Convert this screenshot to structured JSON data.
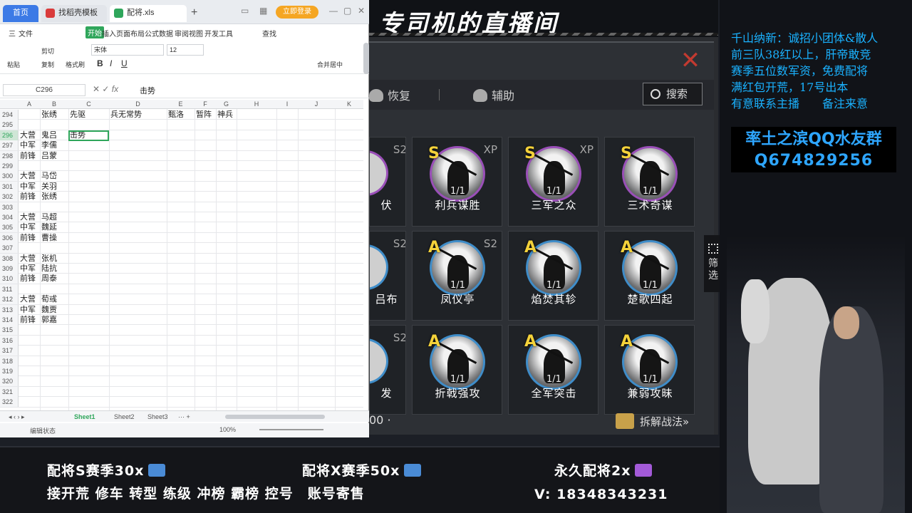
{
  "stream": {
    "title": "专司机的直播间"
  },
  "game": {
    "tabs": {
      "recover": "恢复",
      "assist": "辅助"
    },
    "search": "搜索",
    "filter": "筛选",
    "bottom_number": "00 ·",
    "dismantle": "拆解战法»",
    "cards": [
      {
        "grade": "",
        "tag": "S2",
        "level": "",
        "name": "伏",
        "partial": true,
        "color": "s"
      },
      {
        "grade": "S",
        "tag": "XP",
        "level": "1/1",
        "name": "利兵谋胜"
      },
      {
        "grade": "S",
        "tag": "XP",
        "level": "1/1",
        "name": "三军之众"
      },
      {
        "grade": "S",
        "tag": "",
        "level": "1/1",
        "name": "三术奇谋"
      },
      {
        "grade": "",
        "tag": "S2",
        "level": "",
        "name": "吕布",
        "partial": true,
        "color": "a"
      },
      {
        "grade": "A",
        "tag": "S2",
        "level": "1/1",
        "name": "凤仪亭"
      },
      {
        "grade": "A",
        "tag": "",
        "level": "1/1",
        "name": "焰焚其轸"
      },
      {
        "grade": "A",
        "tag": "",
        "level": "1/1",
        "name": "楚歌四起"
      },
      {
        "grade": "",
        "tag": "S2",
        "level": "",
        "name": "发",
        "partial": true,
        "color": "a"
      },
      {
        "grade": "A",
        "tag": "",
        "level": "1/1",
        "name": "折戟强攻"
      },
      {
        "grade": "A",
        "tag": "",
        "level": "1/1",
        "name": "全军突击"
      },
      {
        "grade": "A",
        "tag": "",
        "level": "1/1",
        "name": "兼弱攻昧"
      }
    ]
  },
  "notice": {
    "lines": [
      "千山纳新：诚招小团体&散人",
      "前三队38红以上，肝帝敢竞",
      "赛季五位数军资，免费配将",
      "满红包开荒，17号出本",
      "有意联系主播　　备注来意"
    ],
    "qq_name": "率土之滨QQ水友群",
    "qq_number": "Q674829256"
  },
  "ad": {
    "a": "配将S赛季30x",
    "b": "配将X赛季50x",
    "c": "永久配将2x",
    "d": "接开荒 修车 转型 练级 冲榜 霸榜 控号　账号寄售",
    "phone": "V: 18348343231"
  },
  "sheet": {
    "browser_tabs": {
      "home": "首页",
      "shell": "找稻壳模板",
      "file": "配将.xls"
    },
    "login": "立即登录",
    "menu": [
      "三",
      "文件",
      "开始",
      "插入",
      "页面布局",
      "公式",
      "数据",
      "审阅",
      "视图",
      "开发工具",
      "查找"
    ],
    "ribbon": {
      "cut": "剪切",
      "copy": "复制",
      "paste": "粘贴",
      "format_painter": "格式刷",
      "font": "宋体",
      "size": "12",
      "merge": "合并居中"
    },
    "name_box": "C296",
    "formula": "击势",
    "columns": [
      "A",
      "B",
      "C",
      "D",
      "E",
      "F",
      "G",
      "H",
      "I",
      "J",
      "K"
    ],
    "rows": [
      {
        "n": "294",
        "a": "",
        "b": "张绣",
        "c": "先驱",
        "d": "兵无常势",
        "e": "甄洛",
        "f": "暂阵",
        "g": "神兵"
      },
      {
        "n": "295",
        "a": "",
        "b": "",
        "c": "",
        "d": "",
        "e": "",
        "f": "",
        "g": ""
      },
      {
        "n": "296",
        "a": "大营",
        "b": "鬼吕",
        "c": "击势",
        "d": "",
        "e": "",
        "f": "",
        "g": ""
      },
      {
        "n": "297",
        "a": "中军",
        "b": "李儒",
        "c": "",
        "d": "",
        "e": "",
        "f": "",
        "g": ""
      },
      {
        "n": "298",
        "a": "前锋",
        "b": "吕蒙",
        "c": "",
        "d": "",
        "e": "",
        "f": "",
        "g": ""
      },
      {
        "n": "299",
        "a": "",
        "b": "",
        "c": "",
        "d": "",
        "e": "",
        "f": "",
        "g": ""
      },
      {
        "n": "300",
        "a": "大营",
        "b": "马岱",
        "c": "",
        "d": "",
        "e": "",
        "f": "",
        "g": ""
      },
      {
        "n": "301",
        "a": "中军",
        "b": "关羽",
        "c": "",
        "d": "",
        "e": "",
        "f": "",
        "g": ""
      },
      {
        "n": "302",
        "a": "前锋",
        "b": "张绣",
        "c": "",
        "d": "",
        "e": "",
        "f": "",
        "g": ""
      },
      {
        "n": "303",
        "a": "",
        "b": "",
        "c": "",
        "d": "",
        "e": "",
        "f": "",
        "g": ""
      },
      {
        "n": "304",
        "a": "大营",
        "b": "马超",
        "c": "",
        "d": "",
        "e": "",
        "f": "",
        "g": ""
      },
      {
        "n": "305",
        "a": "中军",
        "b": "魏延",
        "c": "",
        "d": "",
        "e": "",
        "f": "",
        "g": ""
      },
      {
        "n": "306",
        "a": "前锋",
        "b": "曹操",
        "c": "",
        "d": "",
        "e": "",
        "f": "",
        "g": ""
      },
      {
        "n": "307",
        "a": "",
        "b": "",
        "c": "",
        "d": "",
        "e": "",
        "f": "",
        "g": ""
      },
      {
        "n": "308",
        "a": "大营",
        "b": "张机",
        "c": "",
        "d": "",
        "e": "",
        "f": "",
        "g": ""
      },
      {
        "n": "309",
        "a": "中军",
        "b": "陆抗",
        "c": "",
        "d": "",
        "e": "",
        "f": "",
        "g": ""
      },
      {
        "n": "310",
        "a": "前锋",
        "b": "周泰",
        "c": "",
        "d": "",
        "e": "",
        "f": "",
        "g": ""
      },
      {
        "n": "311",
        "a": "",
        "b": "",
        "c": "",
        "d": "",
        "e": "",
        "f": "",
        "g": ""
      },
      {
        "n": "312",
        "a": "大营",
        "b": "荀彧",
        "c": "",
        "d": "",
        "e": "",
        "f": "",
        "g": ""
      },
      {
        "n": "313",
        "a": "中军",
        "b": "魏贾",
        "c": "",
        "d": "",
        "e": "",
        "f": "",
        "g": ""
      },
      {
        "n": "314",
        "a": "前锋",
        "b": "郭嘉",
        "c": "",
        "d": "",
        "e": "",
        "f": "",
        "g": ""
      },
      {
        "n": "315",
        "a": "",
        "b": "",
        "c": "",
        "d": "",
        "e": "",
        "f": "",
        "g": ""
      },
      {
        "n": "316",
        "a": "",
        "b": "",
        "c": "",
        "d": "",
        "e": "",
        "f": "",
        "g": ""
      },
      {
        "n": "317",
        "a": "",
        "b": "",
        "c": "",
        "d": "",
        "e": "",
        "f": "",
        "g": ""
      },
      {
        "n": "318",
        "a": "",
        "b": "",
        "c": "",
        "d": "",
        "e": "",
        "f": "",
        "g": ""
      },
      {
        "n": "319",
        "a": "",
        "b": "",
        "c": "",
        "d": "",
        "e": "",
        "f": "",
        "g": ""
      },
      {
        "n": "320",
        "a": "",
        "b": "",
        "c": "",
        "d": "",
        "e": "",
        "f": "",
        "g": ""
      },
      {
        "n": "321",
        "a": "",
        "b": "",
        "c": "",
        "d": "",
        "e": "",
        "f": "",
        "g": ""
      },
      {
        "n": "322",
        "a": "",
        "b": "",
        "c": "",
        "d": "",
        "e": "",
        "f": "",
        "g": ""
      }
    ],
    "sheet_tabs": [
      "Sheet1",
      "Sheet2",
      "Sheet3"
    ],
    "status": "编辑状态",
    "zoom": "100%"
  }
}
